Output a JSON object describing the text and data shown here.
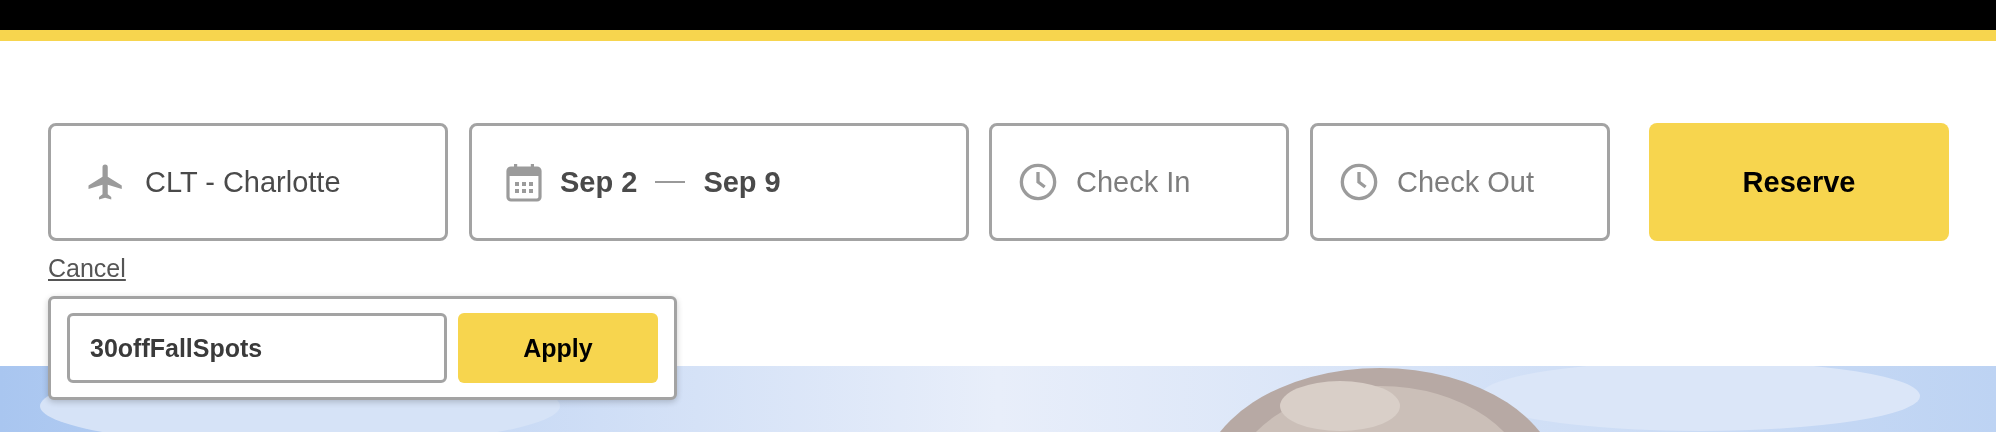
{
  "search_bar": {
    "location": {
      "value": "CLT - Charlotte"
    },
    "dates": {
      "start": "Sep 2",
      "end": "Sep 9"
    },
    "times": [
      {
        "placeholder": "Check In"
      },
      {
        "placeholder": "Check Out"
      }
    ],
    "reserve_button": "Reserve"
  },
  "cancel_link": "Cancel",
  "promo": {
    "value": "30offFallSpots",
    "apply_button": "Apply"
  }
}
